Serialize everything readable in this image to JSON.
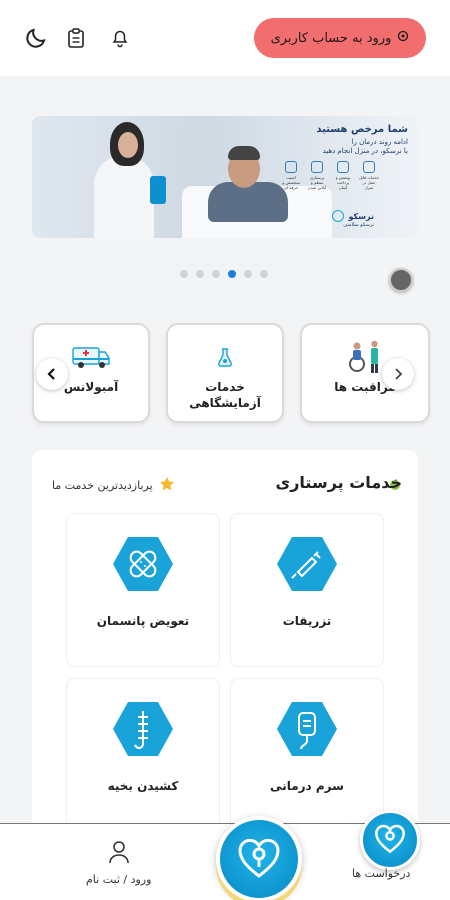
{
  "header": {
    "login_button": "ورود به حساب کاربری",
    "icons": [
      "moon-icon",
      "clipboard-icon",
      "bell-icon",
      "location-pin-icon"
    ]
  },
  "banner": {
    "headline": "شما مرخص هستید",
    "line1": "ادامه روند درمان را",
    "line2": "با نرسکو، در منزل انجام دهید",
    "features": [
      "امنیت متخصص و حرفه ای",
      "پرستاری منظم و آنلاین شدن",
      "پوشش و پرداخت آسان",
      "خدمات قابل حمل در منزل"
    ],
    "brand_name": "نرسکو",
    "brand_sub": "نرسکو سلامتی"
  },
  "carousel": {
    "slides": 6,
    "active_index": 3
  },
  "categories": [
    {
      "name": "مراقبت ها",
      "icon": "caregiver-wheelchair-icon"
    },
    {
      "name": "خدمات\nآزمایشگاهی",
      "icon": "lab-flask-icon"
    },
    {
      "name": "آمبولانس",
      "icon": "ambulance-icon"
    }
  ],
  "nursing": {
    "title": "خدمات پرستاری",
    "most_viewed": "پربازدیدترین خدمت ما",
    "services": [
      {
        "name": "تزریقات",
        "icon": "syringe-icon"
      },
      {
        "name": "تعویض پانسمان",
        "icon": "bandage-icon"
      },
      {
        "name": "سرم درمانی",
        "icon": "iv-bag-icon"
      },
      {
        "name": "کشیدن بخیه",
        "icon": "stitches-icon"
      }
    ]
  },
  "bottom_nav": {
    "login_register": "ورود / ثبت نام",
    "requests": "درخواست ها"
  },
  "colors": {
    "accent_red": "#f26d6d",
    "brand_blue": "#1aa3d9",
    "active_dot": "#1b7fe0",
    "green_dot": "#8bc34a"
  }
}
